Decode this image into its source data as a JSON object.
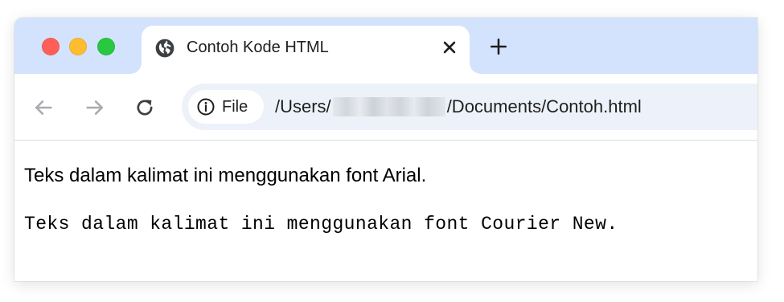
{
  "tab": {
    "title": "Contoh Kode HTML",
    "favicon": "globe-icon"
  },
  "toolbar": {
    "back_icon": "arrow-left-icon",
    "forward_icon": "arrow-right-icon",
    "reload_icon": "reload-icon"
  },
  "address_bar": {
    "chip_label": "File",
    "chip_icon": "info-icon",
    "url_prefix": "/Users/",
    "url_suffix": "/Documents/Contoh.html"
  },
  "page": {
    "paragraphs": [
      "Teks dalam kalimat ini menggunakan font Arial.",
      "Teks dalam kalimat ini menggunakan font Courier New."
    ]
  },
  "colors": {
    "tabbar_bg": "#d3e3fd",
    "omnibox_bg": "#edf2fa",
    "traffic_red": "#ff5f57",
    "traffic_yellow": "#febc2e",
    "traffic_green": "#28c840"
  }
}
